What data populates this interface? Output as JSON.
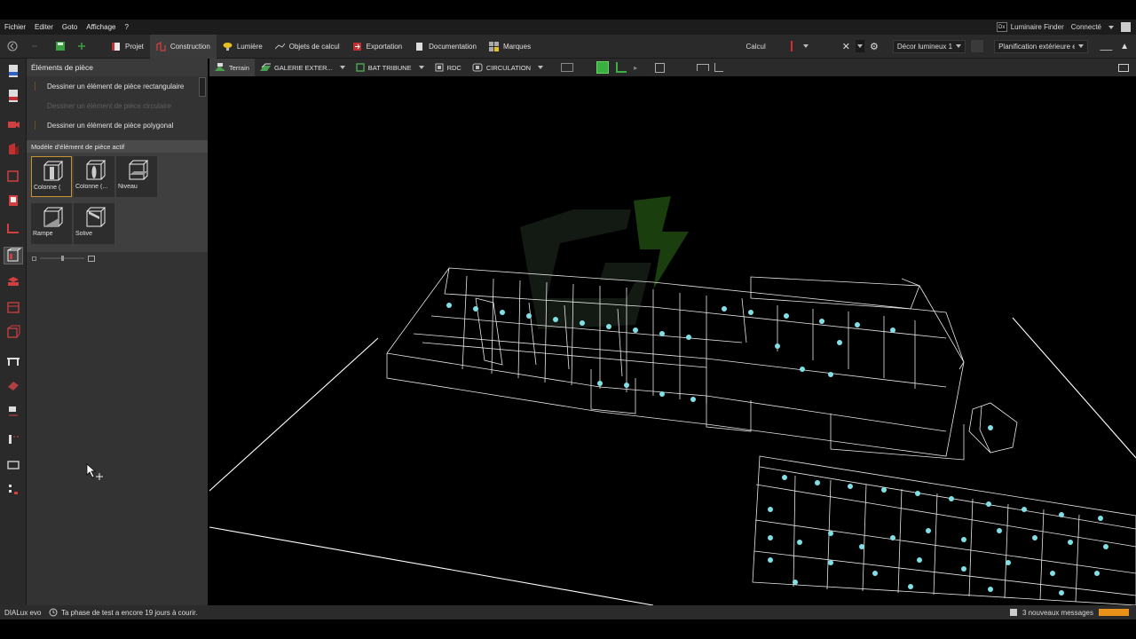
{
  "menu": {
    "items": [
      "Fichier",
      "Editer",
      "Goto",
      "Affichage",
      "?"
    ],
    "luminaire_finder": "Luminaire Finder",
    "connected": "Connecté",
    "lf_badge": "Dx"
  },
  "toolbar": {
    "modes": [
      "Projet",
      "Construction",
      "Lumière",
      "Objets de calcul",
      "Exportation",
      "Documentation",
      "Marques"
    ],
    "active_mode": "Construction",
    "calc_label": "Calcul",
    "scene_dropdown": "Décor lumineux 1",
    "plan_dropdown": "Planification extérieure e..."
  },
  "panel": {
    "title": "Éléments de pièce",
    "actions": [
      "Dessiner un élément de pièce rectangulaire",
      "Dessiner un élément de pièce circulaire",
      "Dessiner un élément de pièce polygonal"
    ],
    "models_header": "Modèle d'élément de pièce actif",
    "tiles": [
      "Colonne (",
      "Colonne (...",
      "Niveau",
      "Rampe",
      "Solive"
    ]
  },
  "viewbar": {
    "items": [
      "Terrain",
      "GALERIE EXTER...",
      "BAT TRIBUNE",
      "RDC",
      "CIRCULATION"
    ]
  },
  "status": {
    "app": "DIALux evo",
    "message": "Ta phase de test a encore 19 jours à courir.",
    "notifications": "3 nouveaux messages"
  },
  "colors": {
    "accent": "#e8921a",
    "active_tile_border": "#c8922e",
    "wireframe": "#ffffff",
    "luminaire": "#7fe0e8",
    "logo_green": "#5db02a"
  }
}
